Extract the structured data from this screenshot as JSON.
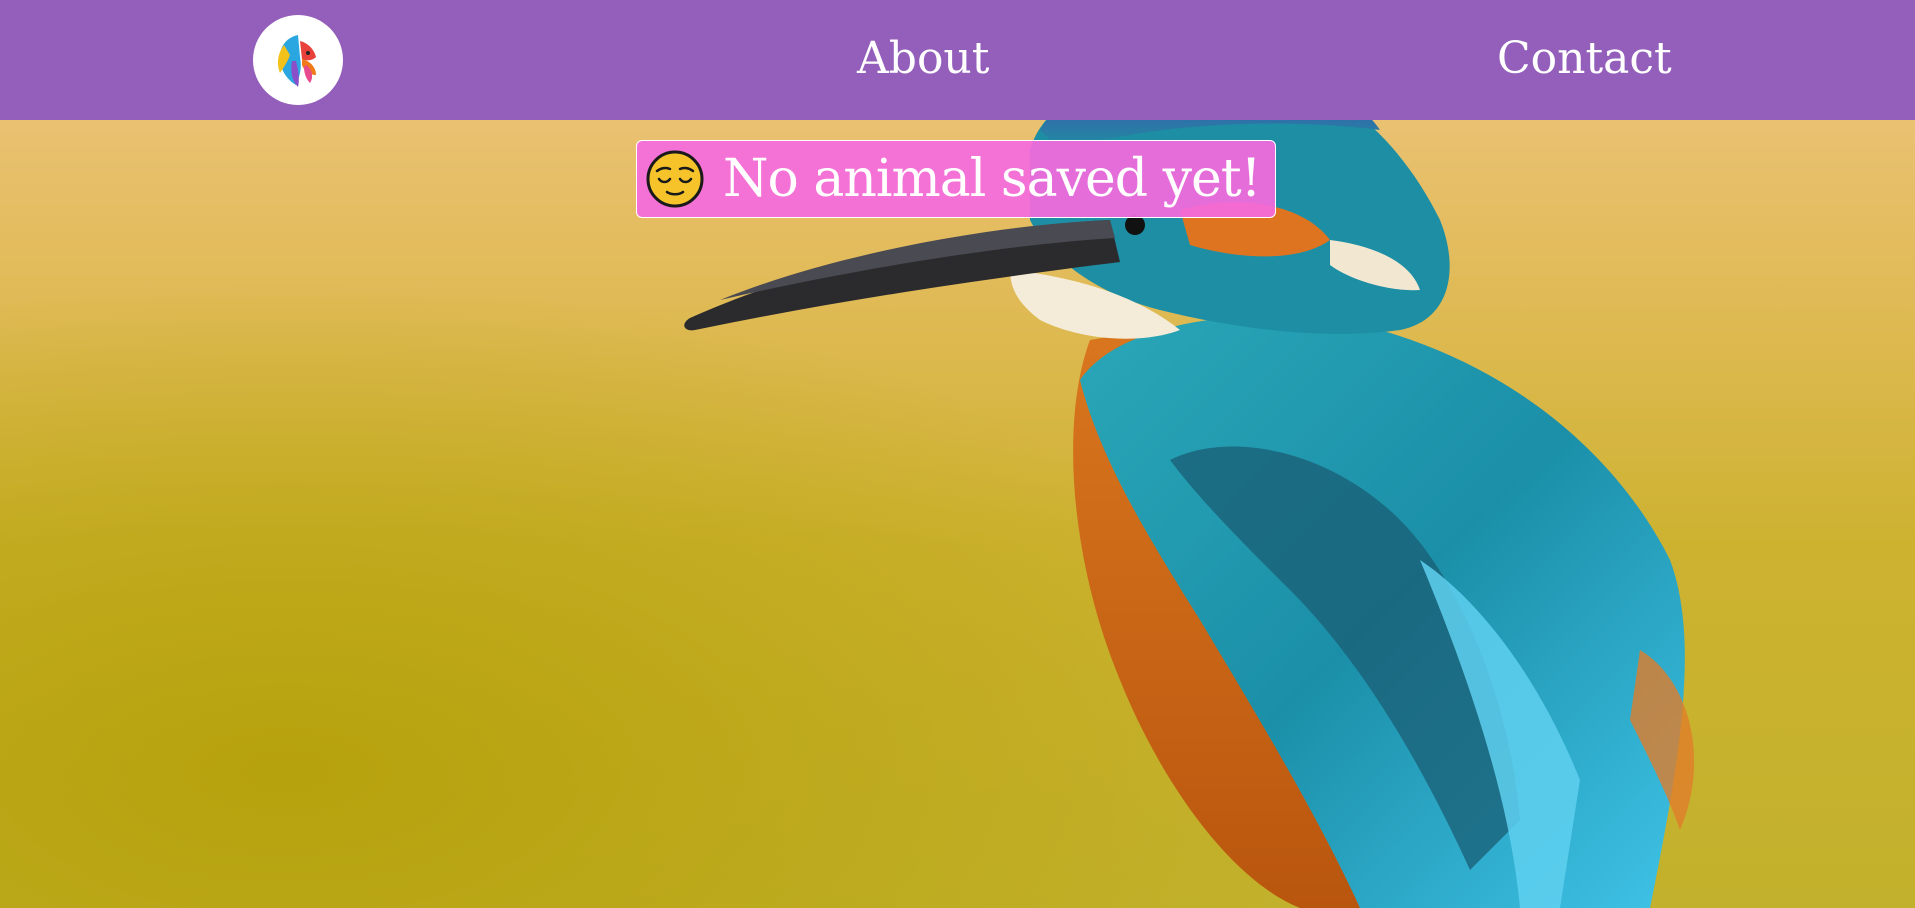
{
  "nav": {
    "logo_icon": "colorful-lion-logo-icon",
    "about_label": "About",
    "contact_label": "Contact",
    "background_color": "#935fba"
  },
  "notice": {
    "emoji_icon": "relieved-face-emoji-icon",
    "text": "No animal saved yet!",
    "background_color": "#f46bde"
  },
  "hero": {
    "image_subject": "kingfisher-photo"
  }
}
